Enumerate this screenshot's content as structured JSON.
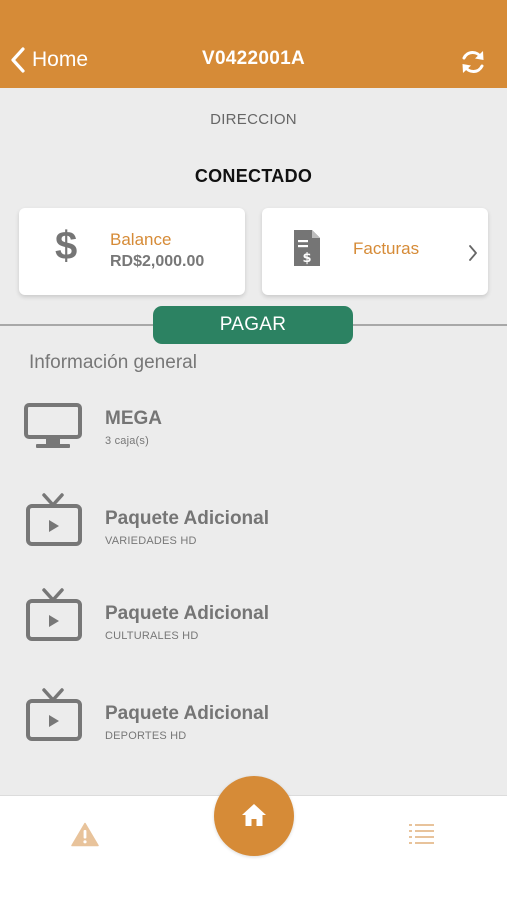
{
  "header": {
    "back_label": "Home",
    "title": "V0422001A",
    "icons": {
      "back": "chevron-left-icon",
      "refresh": "refresh-icon"
    }
  },
  "account": {
    "address": "DIRECCION",
    "status": "CONECTADO"
  },
  "balance_card": {
    "label": "Balance",
    "value": "RD$2,000.00",
    "icon": "dollar-icon"
  },
  "invoices_card": {
    "label": "Facturas",
    "icon": "invoice-document-icon"
  },
  "pay_button": {
    "label": "PAGAR"
  },
  "general_info": {
    "title": "Información general",
    "services": [
      {
        "name": "MEGA",
        "detail": "3 caja(s)",
        "icon": "monitor-icon"
      },
      {
        "name": "Paquete Adicional",
        "detail": "VARIEDADES HD",
        "icon": "tv-play-icon"
      },
      {
        "name": "Paquete Adicional",
        "detail": "CULTURALES HD",
        "icon": "tv-play-icon"
      },
      {
        "name": "Paquete Adicional",
        "detail": "DEPORTES HD",
        "icon": "tv-play-icon"
      }
    ]
  },
  "bottom_nav": {
    "items": [
      "warning-icon",
      "home-icon",
      "list-icon"
    ]
  },
  "colors": {
    "accent": "#d68b37",
    "pay_green": "#2c8262",
    "background": "#ececec"
  }
}
